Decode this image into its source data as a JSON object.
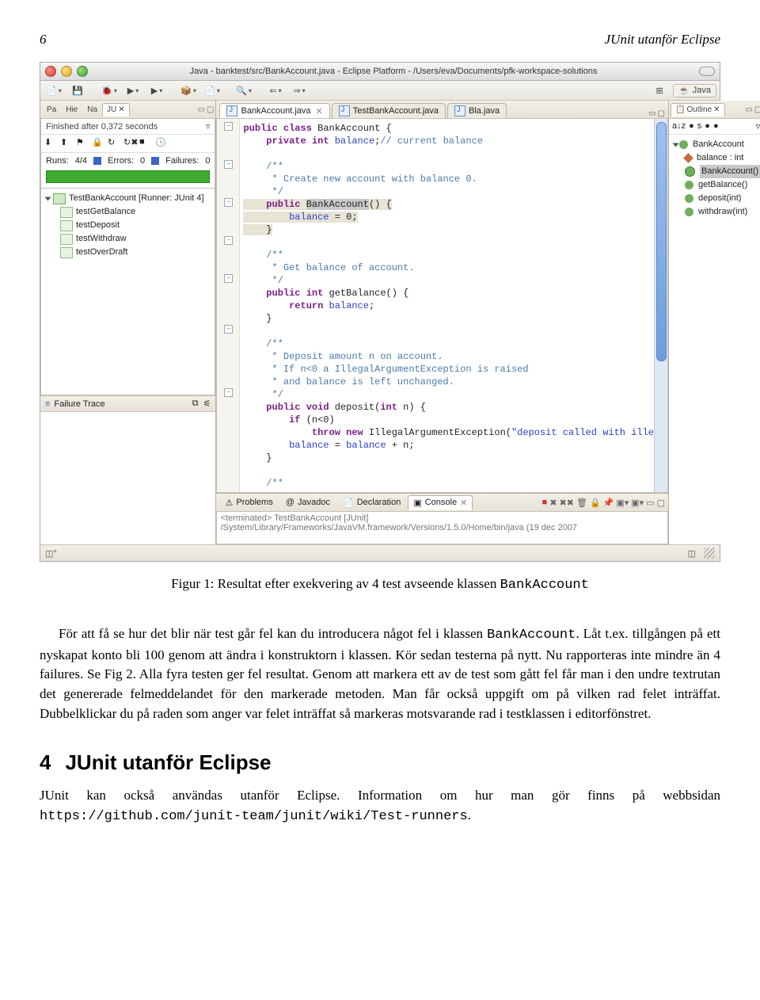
{
  "page_header": {
    "number": "6",
    "title": "JUnit utanför Eclipse"
  },
  "mac_title": "Java - banktest/src/BankAccount.java - Eclipse Platform - /Users/eva/Documents/pfk-workspace-solutions",
  "perspective_label": "Java",
  "junit": {
    "tabs": [
      "Pa",
      "Hie",
      "Na",
      "JU"
    ],
    "status": "Finished after 0,372 seconds",
    "runs_label": "Runs:",
    "runs_value": "4/4",
    "errors_label": "Errors:",
    "errors_value": "0",
    "failures_label": "Failures:",
    "failures_value": "0",
    "suite": "TestBankAccount [Runner: JUnit 4]",
    "tests": [
      "testGetBalance",
      "testDeposit",
      "testWithdraw",
      "testOverDraft"
    ],
    "failure_trace_label": "Failure Trace"
  },
  "editor": {
    "tabs": [
      {
        "label": "BankAccount.java",
        "active": true,
        "close": true
      },
      {
        "label": "TestBankAccount.java",
        "active": false,
        "close": false
      },
      {
        "label": "Bla.java",
        "active": false,
        "close": false
      }
    ]
  },
  "outline": {
    "tab": "Outline",
    "class": "BankAccount",
    "items": [
      {
        "kind": "field",
        "label": "balance : int"
      },
      {
        "kind": "ctor",
        "label": "BankAccount()",
        "selected": true
      },
      {
        "kind": "meth",
        "label": "getBalance()"
      },
      {
        "kind": "meth",
        "label": "deposit(int)"
      },
      {
        "kind": "meth",
        "label": "withdraw(int)"
      }
    ]
  },
  "bottom_tabs": {
    "items": [
      "Problems",
      "Javadoc",
      "Declaration",
      "Console"
    ],
    "console_line": "<terminated> TestBankAccount [JUnit] /System/Library/Frameworks/JavaVM.framework/Versions/1.5.0/Home/bin/java (19 dec 2007"
  },
  "caption_prefix": "Figur 1: Resultat efter exekvering av 4 test avseende klassen ",
  "caption_class": "BankAccount",
  "para1_a": "För att få se hur det blir när test går fel kan du introducera något fel i klassen ",
  "para1_class": "BankAccount",
  "para1_b": ". Låt t.ex. tillgången på ett nyskapat konto bli 100 genom att ändra i konstruktorn i klassen. Kör sedan testerna på nytt. Nu rapporteras inte mindre än 4 failures. Se Fig 2. Alla fyra testen ger fel resultat. Genom att markera ett av de test som gått fel får man i den undre textrutan det genererade felmeddelandet för den markerade metoden. Man får också uppgift om på vilken rad felet inträffat. Dubbelklickar du på raden som anger var felet inträffat så markeras motsvarande rad i testklassen i editorfönstret.",
  "section": {
    "num": "4",
    "title": "JUnit utanför Eclipse"
  },
  "para2_a": "JUnit kan också användas utanför Eclipse. Information om hur man gör finns på webbsidan ",
  "para2_url": "https://github.com/junit-team/junit/wiki/Test-runners",
  "para2_b": ".",
  "chart_data": {
    "type": "table"
  }
}
